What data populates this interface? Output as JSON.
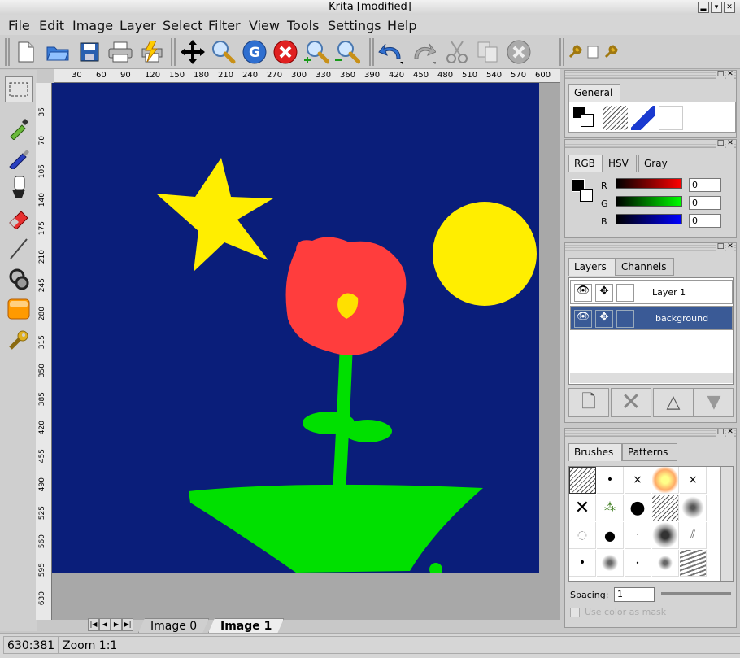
{
  "window": {
    "title": "Krita [modified]",
    "min_glyph": "▂",
    "max_glyph": "▾",
    "close_glyph": "✕"
  },
  "menu": [
    "File",
    "Edit",
    "Image",
    "Layer",
    "Select",
    "Filter",
    "View",
    "Tools",
    "Settings",
    "Help"
  ],
  "toolbar": [
    "new",
    "open",
    "save",
    "print",
    "print-preview",
    "move",
    "zoom",
    "refresh",
    "stop",
    "zoom-in",
    "zoom-out",
    "undo",
    "redo",
    "cut",
    "copy",
    "delete",
    "wrench",
    "page",
    "brush"
  ],
  "hruler_ticks": [
    "30",
    "60",
    "90",
    "120",
    "150",
    "180",
    "210",
    "240",
    "270",
    "300",
    "330",
    "360",
    "390",
    "420",
    "450",
    "480",
    "510",
    "540",
    "570",
    "600"
  ],
  "vruler_ticks": [
    "35",
    "70",
    "105",
    "140",
    "175",
    "210",
    "245",
    "280",
    "315",
    "350",
    "385",
    "420",
    "455",
    "490",
    "525",
    "560",
    "595",
    "630"
  ],
  "doc_tabs": {
    "tab0": "Image 0",
    "tab1": "Image 1"
  },
  "status": {
    "coords": "630:381",
    "zoom": "Zoom 1:1"
  },
  "general": {
    "tab": "General"
  },
  "color": {
    "tabs": {
      "rgb": "RGB",
      "hsv": "HSV",
      "gray": "Gray"
    },
    "r_label": "R",
    "g_label": "G",
    "b_label": "B",
    "r": "0",
    "g": "0",
    "b": "0"
  },
  "layers": {
    "tabs": {
      "layers": "Layers",
      "channels": "Channels"
    },
    "items": [
      {
        "name": "Layer 1"
      },
      {
        "name": "background"
      }
    ]
  },
  "brushes": {
    "tabs": {
      "brushes": "Brushes",
      "patterns": "Patterns"
    },
    "spacing_label": "Spacing:",
    "spacing_value": "1",
    "mask_label": "Use color as mask"
  },
  "colors": {
    "canvas_bg": "#0a1e7a",
    "selected_row": "#3a5a96",
    "star": "#ffee00",
    "flower": "#ff3d3d",
    "stem": "#00e000"
  }
}
